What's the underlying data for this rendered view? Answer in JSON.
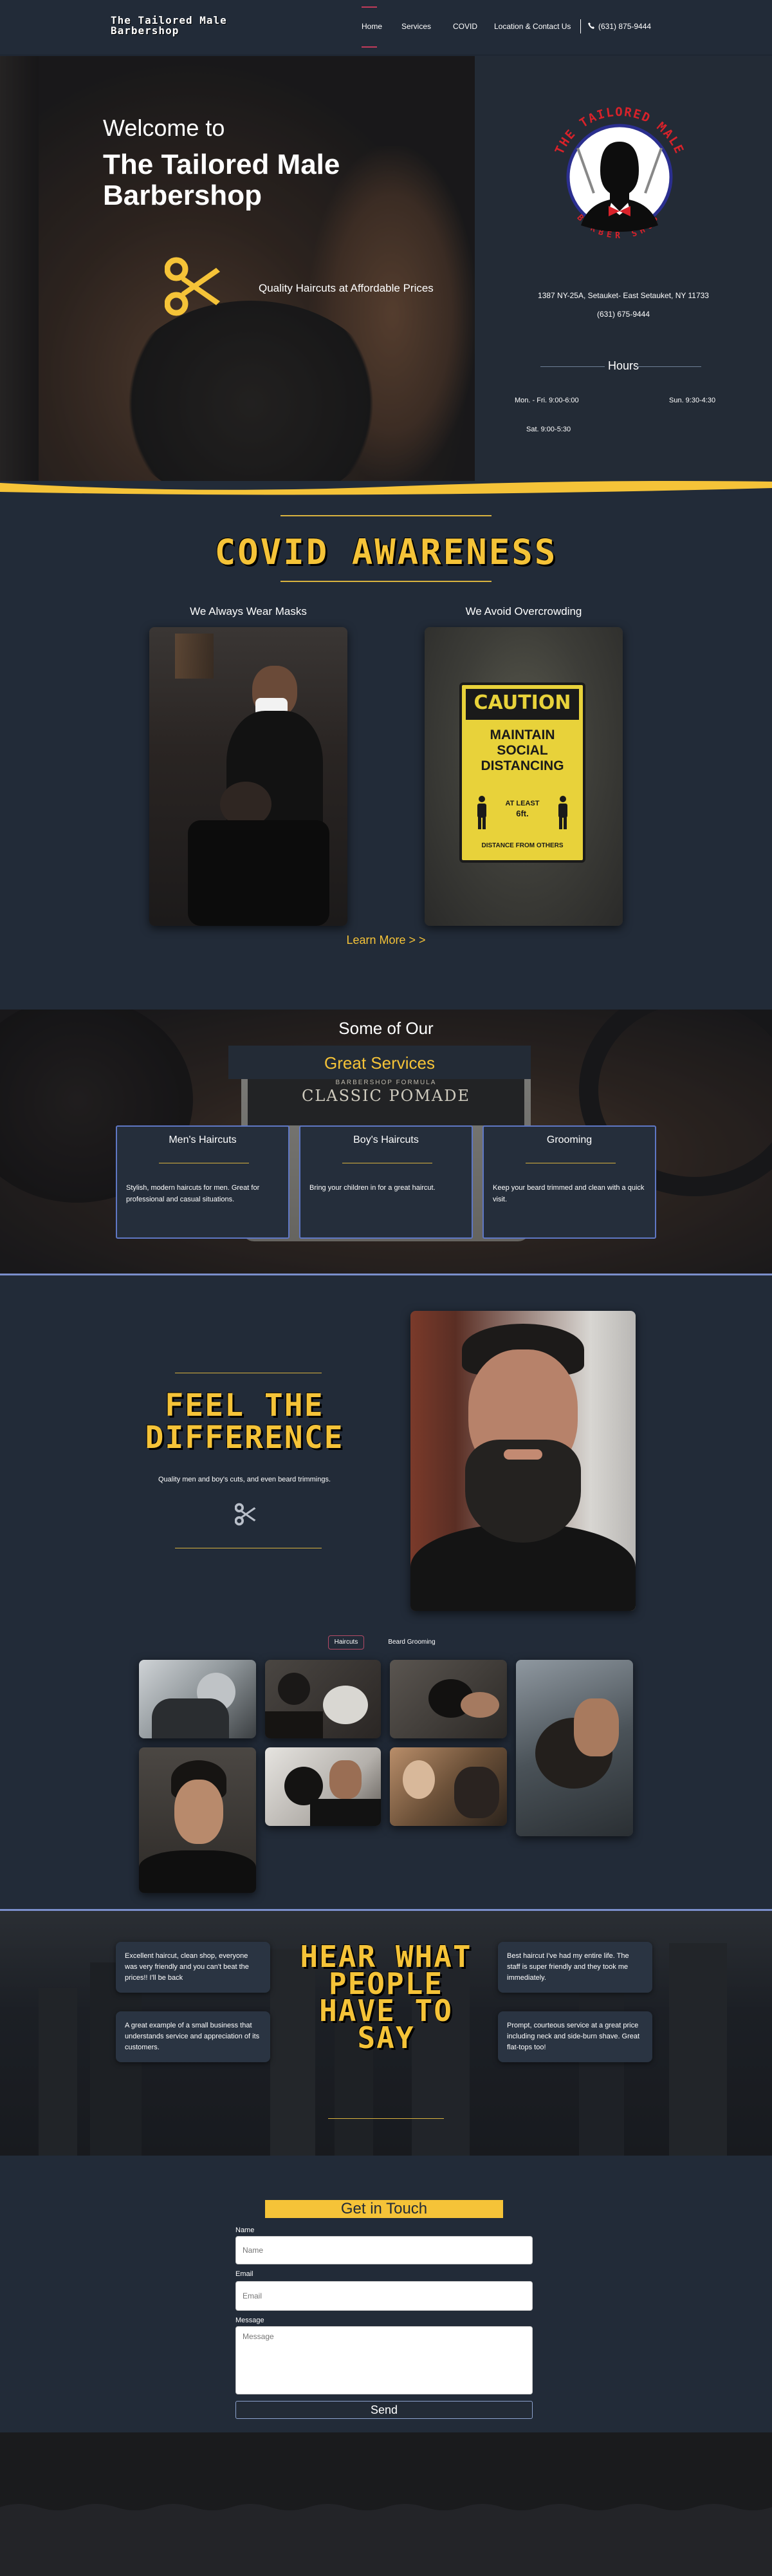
{
  "nav": {
    "brand": "The Tailored Male Barbershop",
    "links": [
      "Home",
      "Services",
      "COVID",
      "Location & Contact Us"
    ],
    "phone": "(631) 875-9444"
  },
  "hero": {
    "welcome": "Welcome to",
    "title": "The Tailored Male Barbershop",
    "tagline": "Quality Haircuts at Affordable Prices",
    "logo_top_text": "THE TAILORED MALE",
    "logo_bottom_text": "BARBER SHOP",
    "address": "1387 NY-25A, Setauket- East Setauket, NY 11733",
    "phone": "(631) 675-9444",
    "hours_title": "Hours",
    "hours": [
      "Mon. - Fri. 9:00-6:00",
      "Sun. 9:30-4:30",
      "Sat. 9:00-5:30"
    ]
  },
  "covid": {
    "title": "COVID AWARENESS",
    "captions": [
      "We Always Wear Masks",
      "We Avoid Overcrowding"
    ],
    "sign_lines": [
      "CAUTION",
      "MAINTAIN",
      "SOCIAL",
      "DISTANCING",
      "AT LEAST",
      "6ft.",
      "DISTANCE FROM OTHERS"
    ],
    "learn_more": "Learn More > >"
  },
  "services": {
    "some_of_our": "Some of Our",
    "great_services": "Great Services",
    "pomade_lines": [
      "BARBERSHOP FORMULA",
      "CLASSIC POMADE"
    ],
    "cards": [
      {
        "title": "Men's Haircuts",
        "text": "Stylish, modern haircuts for men. Great for professional and casual situations."
      },
      {
        "title": "Boy's Haircuts",
        "text": "Bring your children in for a great haircut."
      },
      {
        "title": "Grooming",
        "text": "Keep your beard trimmed and clean with a quick visit."
      }
    ]
  },
  "feel": {
    "title": "FEEL THE DIFFERENCE",
    "subtitle": "Quality men and boy's cuts, and even beard trimmings.",
    "tabs": [
      "Haircuts",
      "Beard Grooming"
    ]
  },
  "testimonials": {
    "title": "HEAR WHAT PEOPLE HAVE TO SAY",
    "quotes": [
      "Excellent haircut, clean shop, everyone was very friendly and you can't beat the prices!!  I'll be back",
      "A great example of a small business that understands service and appreciation of its customers.",
      "Best haircut I've had my entire life. The staff is super friendly and they took me immediately.",
      "Prompt, courteous service at a great price including neck and side-burn shave. Great flat-tops too!"
    ]
  },
  "contact": {
    "title": "Get in Touch",
    "name_label": "Name",
    "name_placeholder": "Name",
    "email_label": "Email",
    "email_placeholder": "Email",
    "message_label": "Message",
    "message_placeholder": "Message",
    "send": "Send"
  },
  "colors": {
    "accent_gold": "#f5c338",
    "page_bg": "#222b38",
    "card_border": "#5f77c4",
    "nav_active": "#c23b5a"
  }
}
